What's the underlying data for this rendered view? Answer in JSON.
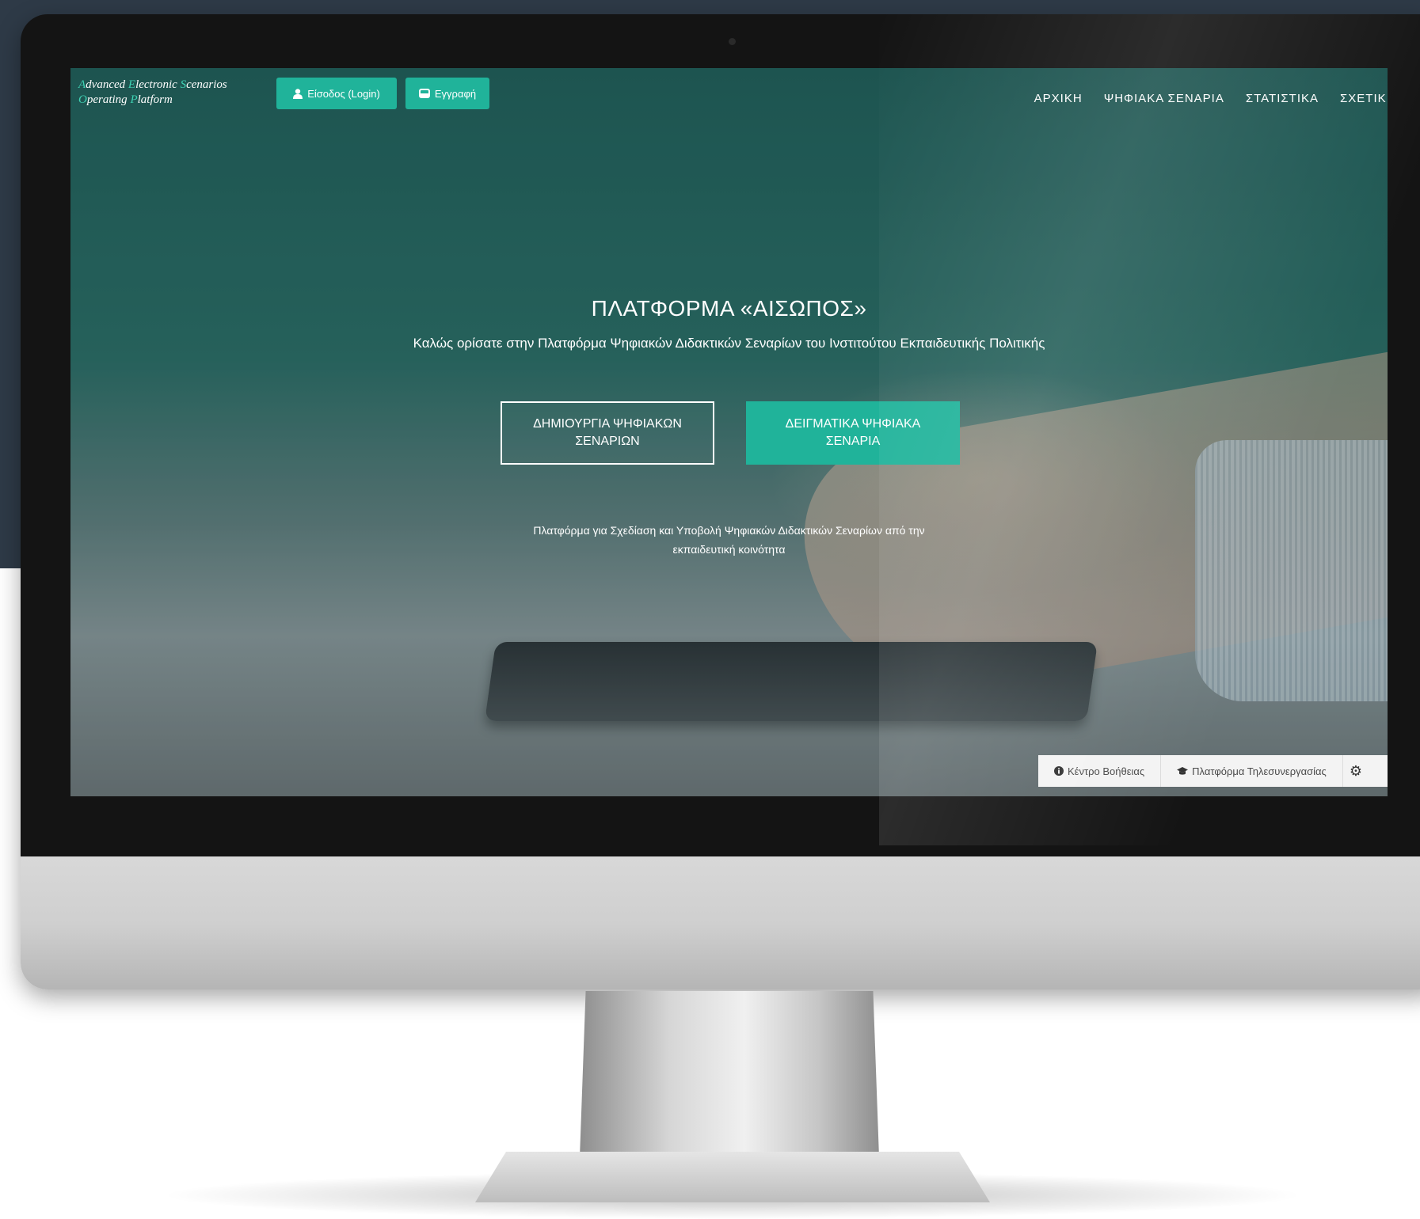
{
  "logo": {
    "line1": [
      {
        "cap": "A",
        "rest": "dvanced "
      },
      {
        "cap": "E",
        "rest": "lectronic "
      },
      {
        "cap": "S",
        "rest": "cenarios"
      }
    ],
    "line2": [
      {
        "cap": "O",
        "rest": "perating "
      },
      {
        "cap": "P",
        "rest": "latform"
      }
    ]
  },
  "header": {
    "login_label": "Είσοδος (Login)",
    "register_label": "Εγγραφή",
    "accent_color": "#20b39a"
  },
  "nav": {
    "items": [
      "ΑΡΧΙΚΗ",
      "ΨΗΦΙΑΚΑ ΣΕΝΑΡΙΑ",
      "ΣΤΑΤΙΣΤΙΚΑ",
      "ΣΧΕΤΙΚ"
    ]
  },
  "hero": {
    "title": "ΠΛΑΤΦΟΡΜΑ «ΑΙΣΩΠΟΣ»",
    "subtitle": "Καλώς ορίσατε στην Πλατφόρμα Ψηφιακών Διδακτικών Σεναρίων του Ινστιτούτου Εκπαιδευτικής Πολιτικής",
    "cta_create": "ΔΗΜΙΟΥΡΓΙΑ ΨΗΦΙΑΚΩΝ ΣΕΝΑΡΙΩΝ",
    "cta_samples": "ΔΕΙΓΜΑΤΙΚΑ ΨΗΦΙΑΚΑ ΣΕΝΑΡΙΑ",
    "description_line1": "Πλατφόρμα για Σχεδίαση και Υποβολή Ψηφιακών Διδακτικών Σεναρίων από την",
    "description_line2": "εκπαιδευτική κοινότητα"
  },
  "bottom_bar": {
    "help_label": "Κέντρο Βοήθειας",
    "help_icon": "info-icon",
    "collab_label": "Πλατφόρμα Τηλεσυνεργασίας",
    "collab_icon": "graduation-cap-icon",
    "settings_icon": "gear-icon"
  }
}
